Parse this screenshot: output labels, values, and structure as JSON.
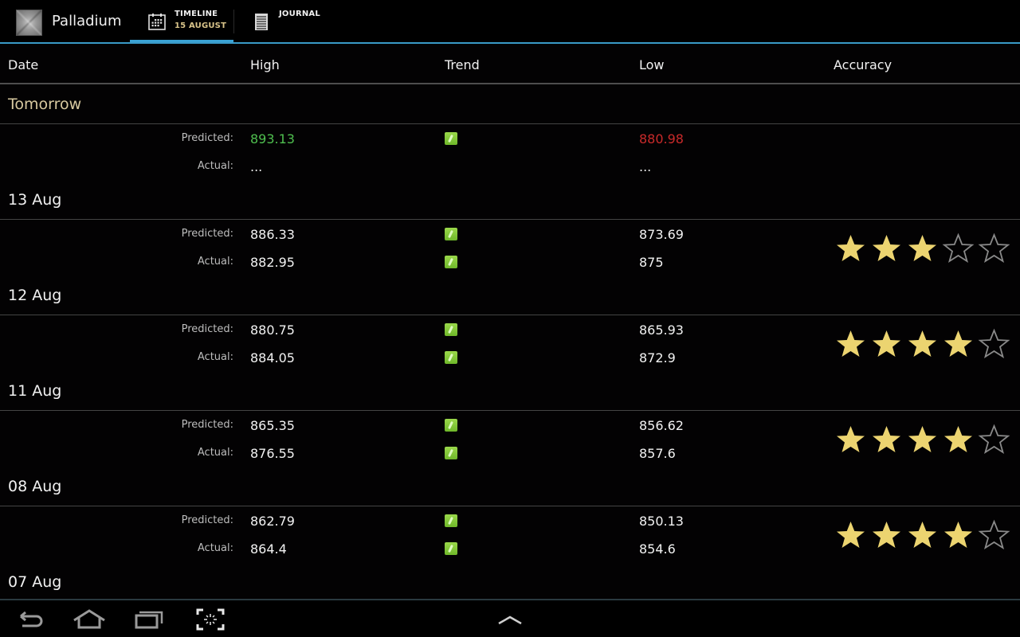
{
  "app": {
    "title": "Palladium",
    "accent_color": "#3a9ac8"
  },
  "tabs": [
    {
      "label": "TIMELINE",
      "sublabel": "15 AUGUST",
      "icon": "calendar-icon",
      "selected": true
    },
    {
      "label": "JOURNAL",
      "sublabel": "",
      "icon": "journal-icon",
      "selected": false
    }
  ],
  "columns": {
    "date": "Date",
    "high": "High",
    "trend": "Trend",
    "low": "Low",
    "accuracy": "Accuracy"
  },
  "labels": {
    "predicted": "Predicted:",
    "actual": "Actual:"
  },
  "section_title": "Tomorrow",
  "rows": [
    {
      "date": "Tomorrow",
      "predicted": {
        "high": "893.13",
        "low": "880.98",
        "trend": "up"
      },
      "actual": {
        "high": "...",
        "low": "...",
        "trend": ""
      },
      "accuracy_stars": null
    },
    {
      "date": "13 Aug",
      "predicted": {
        "high": "886.33",
        "low": "873.69",
        "trend": "up"
      },
      "actual": {
        "high": "882.95",
        "low": "875",
        "trend": "up"
      },
      "accuracy_stars": 3
    },
    {
      "date": "12 Aug",
      "predicted": {
        "high": "880.75",
        "low": "865.93",
        "trend": "up"
      },
      "actual": {
        "high": "884.05",
        "low": "872.9",
        "trend": "up"
      },
      "accuracy_stars": 4
    },
    {
      "date": "11 Aug",
      "predicted": {
        "high": "865.35",
        "low": "856.62",
        "trend": "up"
      },
      "actual": {
        "high": "876.55",
        "low": "857.6",
        "trend": "up"
      },
      "accuracy_stars": 4
    },
    {
      "date": "08 Aug",
      "predicted": {
        "high": "862.79",
        "low": "850.13",
        "trend": "up"
      },
      "actual": {
        "high": "864.4",
        "low": "854.6",
        "trend": "up"
      },
      "accuracy_stars": 4
    }
  ],
  "trailing_date": "07 Aug",
  "colors": {
    "predicted_high_tomorrow": "#4fbf4f",
    "predicted_low_tomorrow": "#c92a2a",
    "star_filled": "#ecd470",
    "star_empty": "#8a8a8a",
    "section_title": "#d8c9a0"
  },
  "navbar": {
    "buttons": [
      "back",
      "home",
      "recent-apps",
      "screenshot"
    ],
    "center": "up-chevron"
  }
}
